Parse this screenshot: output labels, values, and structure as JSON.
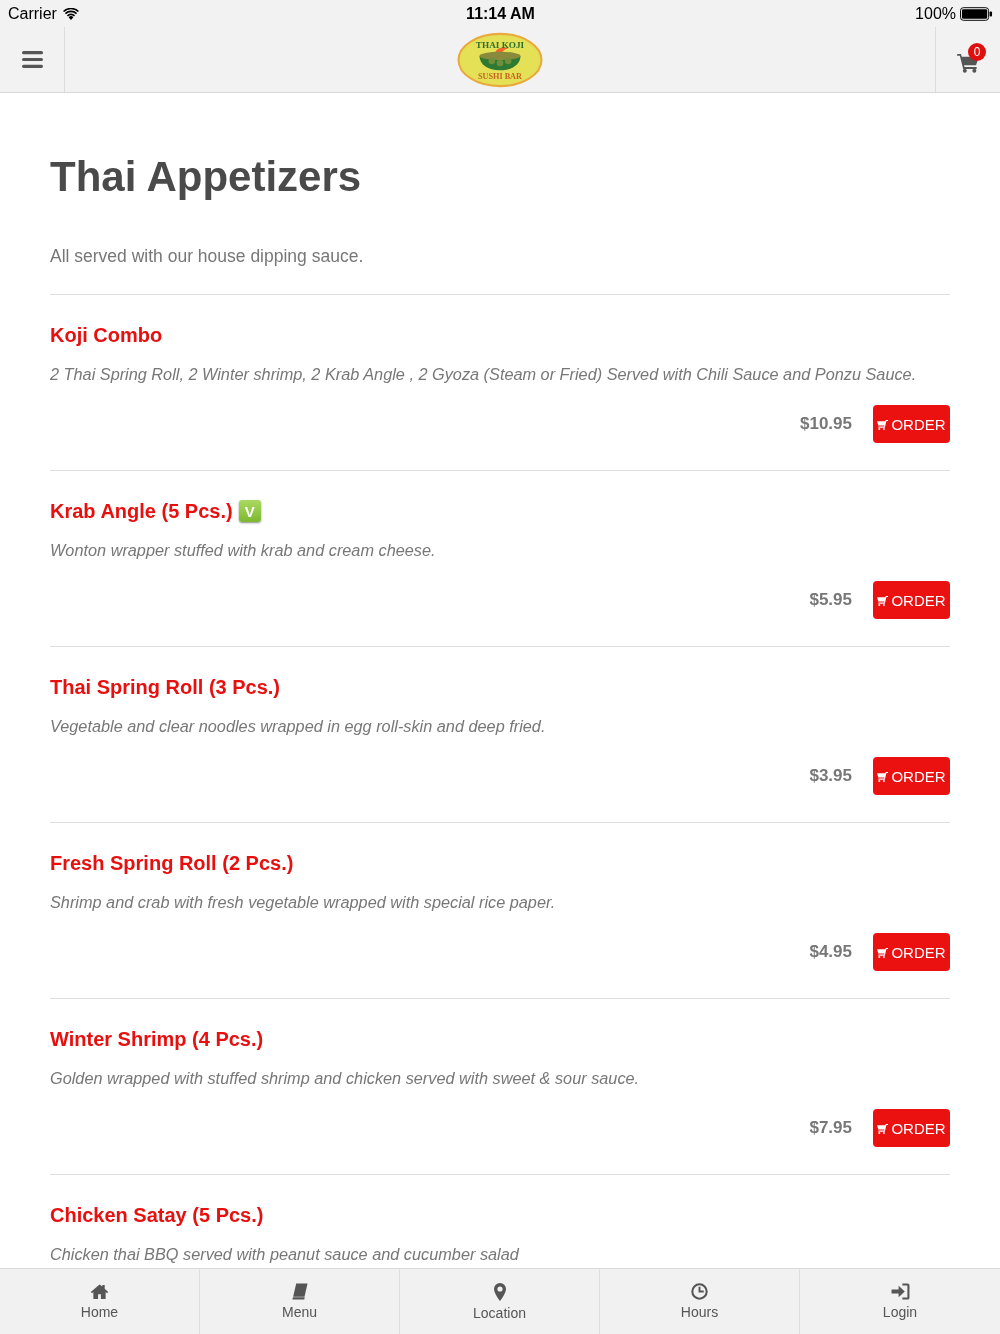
{
  "status_bar": {
    "carrier": "Carrier",
    "time": "11:14 AM",
    "battery": "100%"
  },
  "header": {
    "logo": {
      "top_text": "THAI KOJI",
      "bottom_text": "SUSHI BAR"
    },
    "cart_count": "0"
  },
  "section": {
    "title": "Thai Appetizers",
    "subtitle": "All served with our house dipping sauce."
  },
  "items": [
    {
      "name": "Koji Combo",
      "description": "2 Thai Spring Roll, 2 Winter shrimp, 2 Krab Angle , 2 Gyoza (Steam or Fried) Served with Chili Sauce and Ponzu Sauce.",
      "price": "$10.95",
      "button": "ORDER"
    },
    {
      "name": "Krab Angle (5 Pcs.)",
      "badge": "V",
      "description": "Wonton wrapper stuffed with krab and cream cheese.",
      "price": "$5.95",
      "button": "ORDER"
    },
    {
      "name": "Thai Spring Roll (3 Pcs.)",
      "description": "Vegetable and clear noodles wrapped in egg roll-skin and deep fried.",
      "price": "$3.95",
      "button": "ORDER"
    },
    {
      "name": "Fresh Spring Roll (2 Pcs.)",
      "description": "Shrimp and crab with fresh vegetable wrapped with special rice paper.",
      "price": "$4.95",
      "button": "ORDER"
    },
    {
      "name": "Winter Shrimp (4 Pcs.)",
      "description": "Golden wrapped with stuffed shrimp and chicken served with sweet & sour sauce.",
      "price": "$7.95",
      "button": "ORDER"
    },
    {
      "name": "Chicken Satay (5 Pcs.)",
      "description": "Chicken thai BBQ served with peanut sauce and cucumber salad"
    }
  ],
  "tab_bar": [
    {
      "label": "Home"
    },
    {
      "label": "Menu"
    },
    {
      "label": "Location"
    },
    {
      "label": "Hours"
    },
    {
      "label": "Login"
    }
  ]
}
